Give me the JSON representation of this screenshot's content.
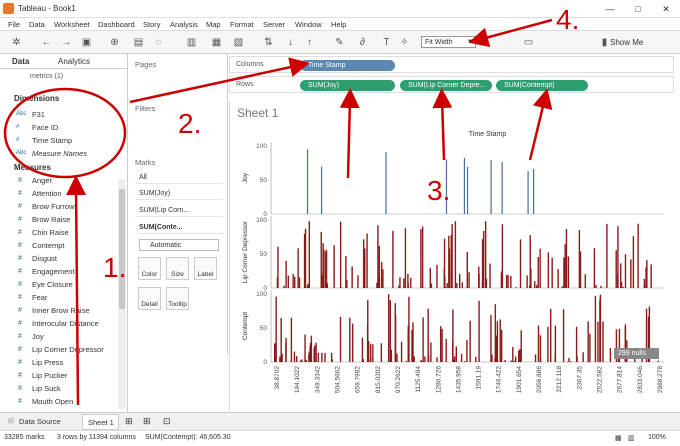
{
  "window": {
    "title": "Tableau - Book1",
    "min_label": "—",
    "max_label": "□",
    "close_label": "✕"
  },
  "menu": [
    "File",
    "Data",
    "Worksheet",
    "Dashboard",
    "Story",
    "Analysis",
    "Map",
    "Format",
    "Server",
    "Window",
    "Help"
  ],
  "toolbar": {
    "fit_value": "Fit Width",
    "show_me_label": "Show Me"
  },
  "left_pane": {
    "tab_data": "Data",
    "tab_analytics": "Analytics",
    "datasource": "metrics (1)",
    "dimensions_header": "Dimensions",
    "measures_header": "Measures",
    "dimensions": [
      {
        "type": "Abc",
        "name": "F31"
      },
      {
        "type": "#",
        "name": "Face ID"
      },
      {
        "type": "#",
        "name": "Time Stamp"
      },
      {
        "type": "Abc",
        "name": "Measure Names"
      }
    ],
    "measures": [
      "Anger",
      "Attention",
      "Brow Furrow",
      "Brow Raise",
      "Chin Raise",
      "Contempt",
      "Disgust",
      "Engagement",
      "Eye Closure",
      "Fear",
      "Inner Brow Raise",
      "Interocular Distance",
      "Joy",
      "Lip Corner Depressor",
      "Lip Press",
      "Lip Pucker",
      "Lip Suck",
      "Mouth Open"
    ]
  },
  "cards": {
    "pages_label": "Pages",
    "filters_label": "Filters",
    "marks_label": "Marks",
    "marks_items": [
      "All",
      "SUM(Joy)",
      "SUM(Lip Corn...",
      "SUM(Conte..."
    ],
    "mark_type": "Automatic",
    "color_label": "Color",
    "size_label": "Size",
    "label_label": "Label",
    "detail_label": "Detail",
    "tooltip_label": "Tooltip"
  },
  "shelves": {
    "columns_label": "Columns",
    "rows_label": "Rows",
    "column_pills": [
      "Time Stamp"
    ],
    "row_pills": [
      "SUM(Joy)",
      "SUM(Lip Corner Depre...",
      "SUM(Contempt)"
    ]
  },
  "sheet": {
    "title": "Sheet 1",
    "x_header": "Time Stamp",
    "nulls_badge": "299 nulls"
  },
  "chart_data": {
    "type": "bar",
    "x_ticks": [
      "38.8702",
      "194.1022",
      "349.3342",
      "504.5662",
      "659.7982",
      "815.0302",
      "970.2622",
      "1125.494",
      "1280.726",
      "1435.958",
      "1591.19",
      "1746.422",
      "1901.654",
      "2056.886",
      "2212.118",
      "2367.35",
      "2522.582",
      "2677.814",
      "2833.046",
      "2988.278"
    ],
    "series": [
      {
        "name": "Joy",
        "y_label": "Joy",
        "y_ticks": [
          "0",
          "50",
          "100"
        ],
        "ylim": [
          0,
          100
        ]
      },
      {
        "name": "Lip Corner Depressor",
        "y_label": "Lip Corner Depressor",
        "y_ticks": [
          "0",
          "50",
          "100"
        ],
        "ylim": [
          0,
          100
        ]
      },
      {
        "name": "Contempt",
        "y_label": "Contempt",
        "y_ticks": [
          "0",
          "50",
          "100"
        ],
        "ylim": [
          0,
          100
        ]
      }
    ]
  },
  "bottom": {
    "datasource_tab": "Data Source",
    "sheet_tab": "Sheet 1"
  },
  "status": {
    "marks": "33285 marks",
    "rows_cols": "3 rows by 11394 columns",
    "sum": "SUM(Contempt): 46,605.30",
    "zoom": "100%"
  },
  "annotations": [
    "1.",
    "2.",
    "3.",
    "4."
  ],
  "colors": {
    "bar_red": "#8b1a1a",
    "bar_blue": "#4a6f9a",
    "annotation_red": "#cc0000",
    "pill_green": "#2e9d70",
    "pill_blue": "#5b87b1"
  }
}
